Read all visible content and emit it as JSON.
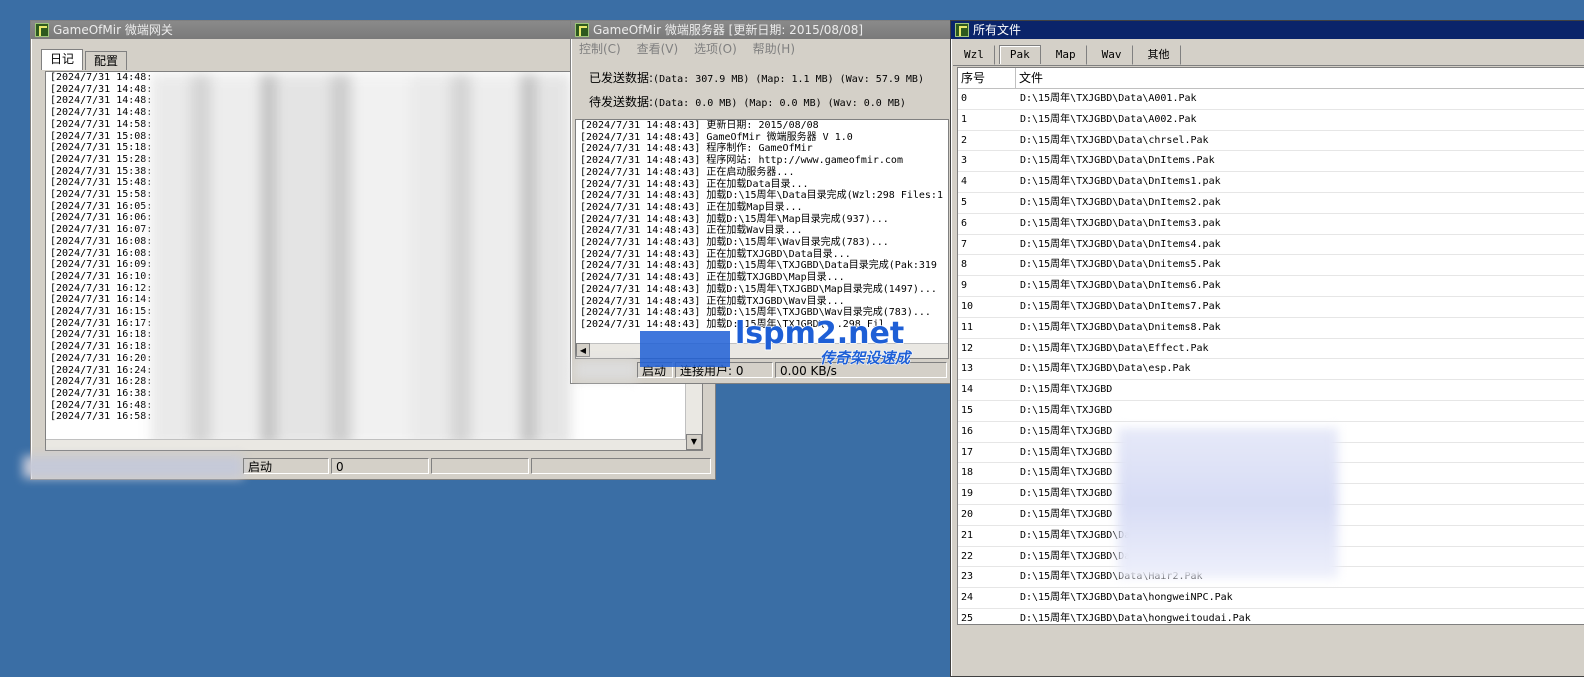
{
  "gateway": {
    "title": "GameOfMir 微端网关",
    "tabs": [
      "日记",
      "配置"
    ],
    "log_lines": [
      "[2024/7/31 14:48:",
      "[2024/7/31 14:48:",
      "[2024/7/31 14:48:",
      "[2024/7/31 14:48:",
      "[2024/7/31 14:58:",
      "[2024/7/31 15:08:",
      "[2024/7/31 15:18:",
      "[2024/7/31 15:28:",
      "[2024/7/31 15:38:",
      "[2024/7/31 15:48:",
      "[2024/7/31 15:58:",
      "[2024/7/31 16:05:",
      "[2024/7/31 16:06:",
      "[2024/7/31 16:07:",
      "[2024/7/31 16:08:",
      "[2024/7/31 16:08:",
      "[2024/7/31 16:09:",
      "[2024/7/31 16:10:",
      "[2024/7/31 16:12:",
      "[2024/7/31 16:14:",
      "[2024/7/31 16:15:",
      "[2024/7/31 16:17:",
      "[2024/7/31 16:18:",
      "[2024/7/31 16:18:",
      "[2024/7/31 16:20:",
      "[2024/7/31 16:24:",
      "[2024/7/31 16:28:",
      "[2024/7/31 16:38:",
      "[2024/7/31 16:48:",
      "[2024/7/31 16:58:"
    ],
    "status": {
      "state": "启动",
      "count": "0"
    }
  },
  "server": {
    "title": "GameOfMir 微端服务器 [更新日期: 2015/08/08]",
    "menu": [
      "控制(C)",
      "查看(V)",
      "选项(O)",
      "帮助(H)"
    ],
    "sent_label": "已发送数据:",
    "sent_value": "(Data: 307.9 MB) (Map: 1.1 MB) (Wav: 57.9 MB)",
    "pending_label": "待发送数据:",
    "pending_value": "(Data: 0.0 MB) (Map: 0.0 MB) (Wav: 0.0 MB)",
    "log_lines": [
      "[2024/7/31 14:48:43] 更新日期: 2015/08/08",
      "[2024/7/31 14:48:43] GameOfMir 微端服务器 V 1.0",
      "[2024/7/31 14:48:43] 程序制作: GameOfMir",
      "[2024/7/31 14:48:43] 程序网站: http://www.gameofmir.com",
      "[2024/7/31 14:48:43] 正在启动服务器...",
      "[2024/7/31 14:48:43] 正在加载Data目录...",
      "[2024/7/31 14:48:43] 加载D:\\15周年\\Data目录完成(Wzl:298 Files:1",
      "[2024/7/31 14:48:43] 正在加载Map目录...",
      "[2024/7/31 14:48:43] 加载D:\\15周年\\Map目录完成(937)...",
      "[2024/7/31 14:48:43] 正在加载Wav目录...",
      "[2024/7/31 14:48:43] 加载D:\\15周年\\Wav目录完成(783)...",
      "[2024/7/31 14:48:43] 正在加载TXJGBD\\Data目录...",
      "[2024/7/31 14:48:43] 加载D:\\15周年\\TXJGBD\\Data目录完成(Pak:319",
      "[2024/7/31 14:48:43] 正在加载TXJGBD\\Map目录...",
      "[2024/7/31 14:48:43] 加载D:\\15周年\\TXJGBD\\Map目录完成(1497)...",
      "[2024/7/31 14:48:43] 正在加载TXJGBD\\Wav目录...",
      "[2024/7/31 14:48:43] 加载D:\\15周年\\TXJGBD\\Wav目录完成(783)...",
      "[2024/7/31 14:48:43] 加载D:\\15周年\\TXJGBD\\...298 Fil"
    ],
    "status": {
      "state": "启动",
      "users": "连接用户: 0",
      "speed": "0.00 KB/s"
    }
  },
  "files": {
    "title": "所有文件",
    "tabs": [
      "Wzl",
      "Pak",
      "Map",
      "Wav",
      "其他"
    ],
    "selected_tab": "Pak",
    "columns": [
      "序号",
      "文件"
    ],
    "rows": [
      [
        "0",
        "D:\\15周年\\TXJGBD\\Data\\A001.Pak"
      ],
      [
        "1",
        "D:\\15周年\\TXJGBD\\Data\\A002.Pak"
      ],
      [
        "2",
        "D:\\15周年\\TXJGBD\\Data\\chrsel.Pak"
      ],
      [
        "3",
        "D:\\15周年\\TXJGBD\\Data\\DnItems.Pak"
      ],
      [
        "4",
        "D:\\15周年\\TXJGBD\\Data\\DnItems1.pak"
      ],
      [
        "5",
        "D:\\15周年\\TXJGBD\\Data\\DnItems2.pak"
      ],
      [
        "6",
        "D:\\15周年\\TXJGBD\\Data\\DnItems3.pak"
      ],
      [
        "7",
        "D:\\15周年\\TXJGBD\\Data\\DnItems4.pak"
      ],
      [
        "8",
        "D:\\15周年\\TXJGBD\\Data\\Dnitems5.Pak"
      ],
      [
        "9",
        "D:\\15周年\\TXJGBD\\Data\\DnItems6.Pak"
      ],
      [
        "10",
        "D:\\15周年\\TXJGBD\\Data\\DnItems7.Pak"
      ],
      [
        "11",
        "D:\\15周年\\TXJGBD\\Data\\Dnitems8.Pak"
      ],
      [
        "12",
        "D:\\15周年\\TXJGBD\\Data\\Effect.Pak"
      ],
      [
        "13",
        "D:\\15周年\\TXJGBD\\Data\\esp.Pak"
      ],
      [
        "14",
        "D:\\15周年\\TXJGBD"
      ],
      [
        "15",
        "D:\\15周年\\TXJGBD"
      ],
      [
        "16",
        "D:\\15周年\\TXJGBD"
      ],
      [
        "17",
        "D:\\15周年\\TXJGBD"
      ],
      [
        "18",
        "D:\\15周年\\TXJGBD"
      ],
      [
        "19",
        "D:\\15周年\\TXJGBD"
      ],
      [
        "20",
        "D:\\15周年\\TXJGBD"
      ],
      [
        "21",
        "D:\\15周年\\TXJGBD\\Data\\..Pak"
      ],
      [
        "22",
        "D:\\15周年\\TXJGBD\\Data\\guanghuan.Pak"
      ],
      [
        "23",
        "D:\\15周年\\TXJGBD\\Data\\Hair2.Pak"
      ],
      [
        "24",
        "D:\\15周年\\TXJGBD\\Data\\hongweiNPC.Pak"
      ],
      [
        "25",
        "D:\\15周年\\TXJGBD\\Data\\hongweitoudai.Pak"
      ]
    ]
  },
  "watermark": {
    "line1": "lspm2.net",
    "line2": "传奇架设速成"
  },
  "colors": {
    "desktop": "#3a6ea5",
    "active_title": "#0a246a",
    "watermark_blue": "#1e5fd6"
  }
}
